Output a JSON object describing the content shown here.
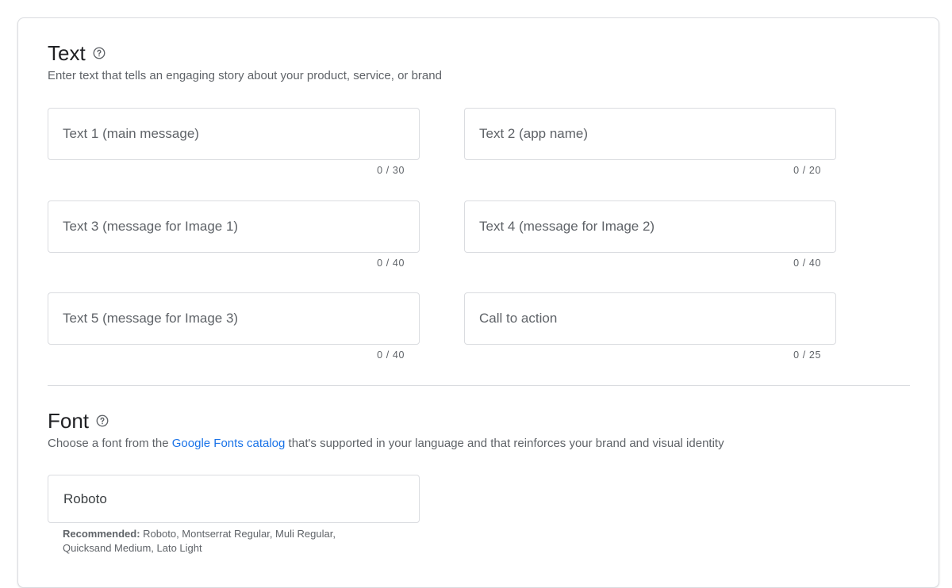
{
  "text_section": {
    "title": "Text",
    "description": "Enter text that tells an engaging story about your product, service, or brand",
    "help_icon": "help-circle-icon",
    "fields": [
      {
        "placeholder": "Text 1 (main message)",
        "value": "",
        "counter": "0 / 30"
      },
      {
        "placeholder": "Text 2 (app name)",
        "value": "",
        "counter": "0 / 20"
      },
      {
        "placeholder": "Text 3 (message for Image 1)",
        "value": "",
        "counter": "0 / 40"
      },
      {
        "placeholder": "Text 4 (message for Image 2)",
        "value": "",
        "counter": "0 / 40"
      },
      {
        "placeholder": "Text 5 (message for Image 3)",
        "value": "",
        "counter": "0 / 40"
      },
      {
        "placeholder": "Call to action",
        "value": "",
        "counter": "0 / 25"
      }
    ]
  },
  "font_section": {
    "title": "Font",
    "help_icon": "help-circle-icon",
    "description_before": "Choose a font from the ",
    "description_link": "Google Fonts catalog",
    "description_after": " that's supported in your language and that reinforces your brand and visual identity",
    "field_value": "Roboto",
    "recommended_label": "Recommended:",
    "recommended_text": " Roboto, Montserrat Regular, Muli Regular, Quicksand Medium, Lato Light"
  },
  "colors": {
    "accent": "#1a73e8",
    "border": "#dadce0",
    "secondary_text": "#5f6368"
  }
}
